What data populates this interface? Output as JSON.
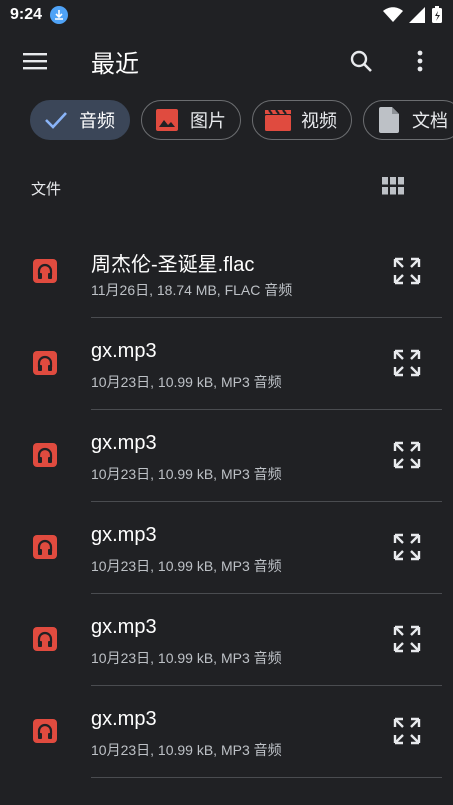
{
  "status_bar": {
    "time": "9:24"
  },
  "app_bar": {
    "title": "最近"
  },
  "chips": [
    {
      "label": "音频",
      "icon": "check-icon",
      "selected": true
    },
    {
      "label": "图片",
      "icon": "image-icon",
      "selected": false
    },
    {
      "label": "视频",
      "icon": "movie-icon",
      "selected": false
    },
    {
      "label": "文档",
      "icon": "document-icon",
      "selected": false
    }
  ],
  "section": {
    "title": "文件"
  },
  "files": [
    {
      "name": "周杰伦-圣诞星.flac",
      "meta": "11月26日, 18.74 MB, FLAC 音频",
      "icon": "headphones-icon"
    },
    {
      "name": "gx.mp3",
      "meta": "10月23日, 10.99 kB, MP3 音频",
      "icon": "headphones-icon"
    },
    {
      "name": "gx.mp3",
      "meta": "10月23日, 10.99 kB, MP3 音频",
      "icon": "headphones-icon"
    },
    {
      "name": "gx.mp3",
      "meta": "10月23日, 10.99 kB, MP3 音频",
      "icon": "headphones-icon"
    },
    {
      "name": "gx.mp3",
      "meta": "10月23日, 10.99 kB, MP3 音频",
      "icon": "headphones-icon"
    },
    {
      "name": "gx.mp3",
      "meta": "10月23日, 10.99 kB, MP3 音频",
      "icon": "headphones-icon"
    }
  ],
  "colors": {
    "background": "#202124",
    "selected_chip": "#3b4658",
    "accent": "#8ab4f8",
    "audio_icon": "#e04b3f",
    "image_icon": "#e04b3f",
    "video_icon": "#e04b3f"
  }
}
